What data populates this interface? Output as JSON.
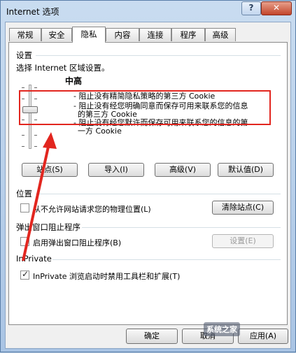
{
  "window": {
    "title": "Internet 选项",
    "help": "?",
    "close": "✕"
  },
  "tabs": [
    "常规",
    "安全",
    "隐私",
    "内容",
    "连接",
    "程序",
    "高级"
  ],
  "settings": {
    "section": "设置",
    "zone_label": "选择 Internet 区域设置。",
    "level": "中高",
    "desc1": "- 阻止没有精简隐私策略的第三方 Cookie",
    "desc2a": "- 阻止没有经您明确同意而保存可用来联系您的信息",
    "desc2b": "的第三方 Cookie",
    "desc3a": "- 阻止没有经您默许而保存可用来联系您的信息的第",
    "desc3b": "一方 Cookie",
    "buttons": {
      "sites": "站点(S)",
      "import": "导入(I)",
      "advanced": "高级(V)",
      "default": "默认值(D)"
    }
  },
  "location": {
    "section": "位置",
    "checkbox": "从不允许网站请求您的物理位置(L)",
    "clear": "清除站点(C)"
  },
  "popup": {
    "section": "弹出窗口阻止程序",
    "checkbox": "启用弹出窗口阻止程序(B)",
    "settings": "设置(E)"
  },
  "inprivate": {
    "section": "InPrivate",
    "checkbox": "InPrivate 浏览启动时禁用工具栏和扩展(T)"
  },
  "footer": {
    "ok": "确定",
    "cancel": "取消",
    "apply": "应用(A)"
  },
  "watermark": "系统之家",
  "colors": {
    "annotation": "#e2261f"
  }
}
